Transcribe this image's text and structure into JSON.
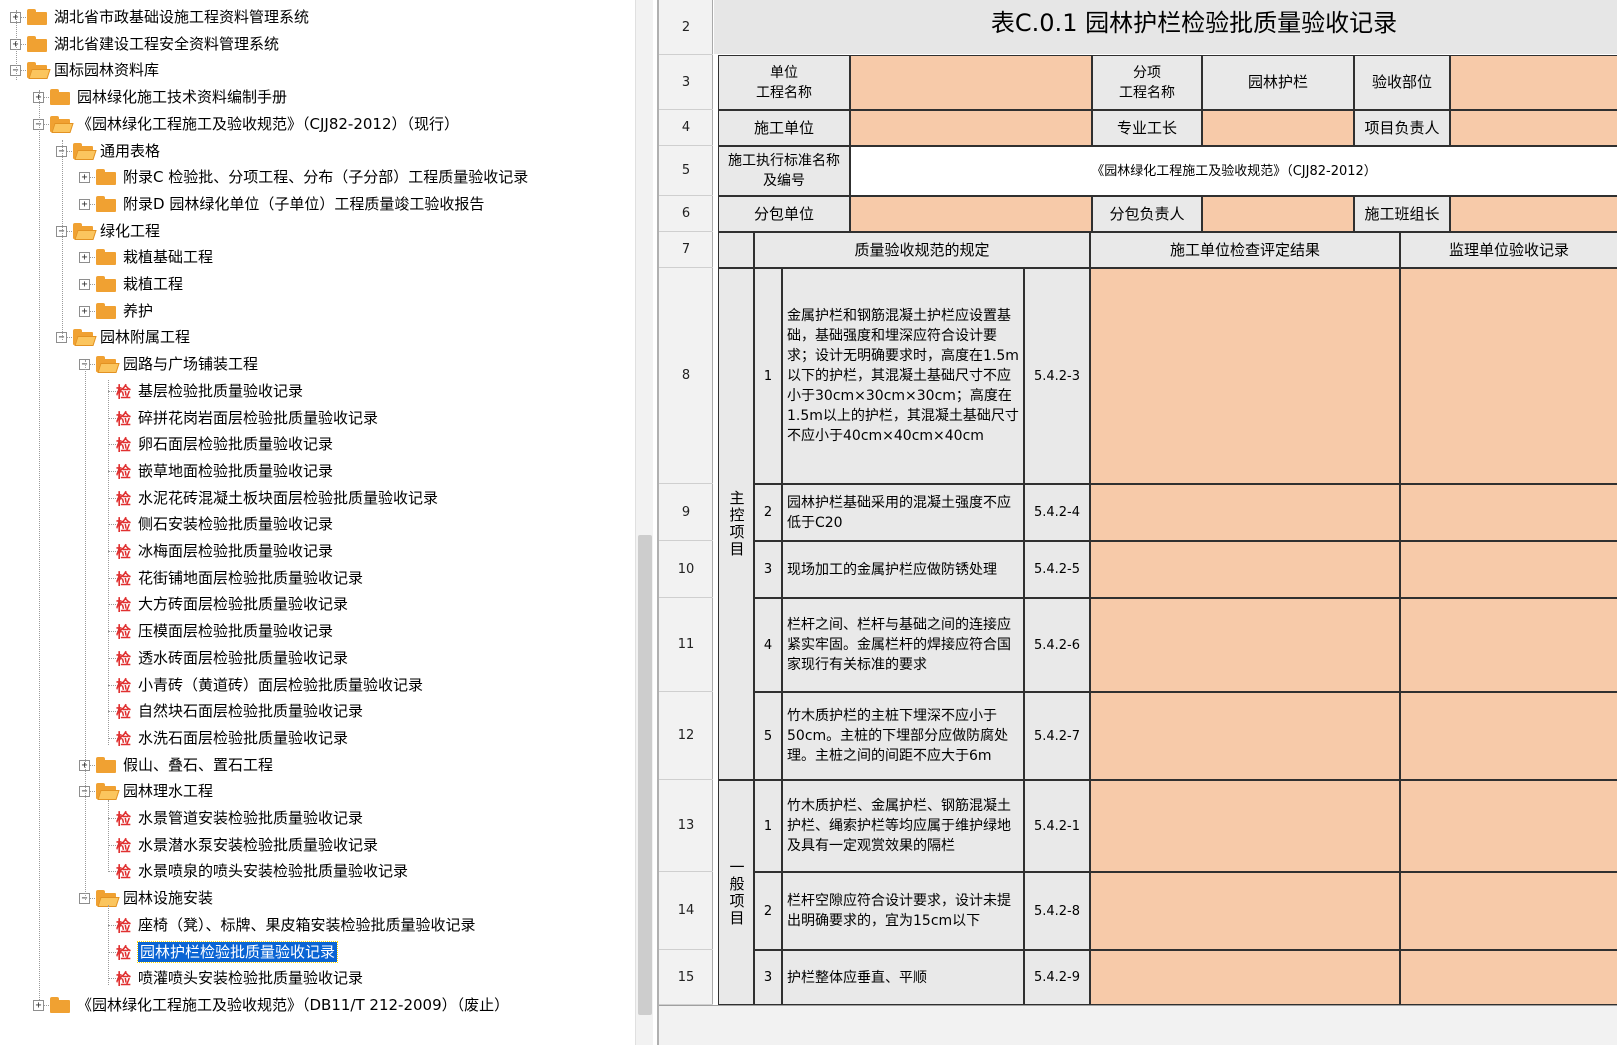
{
  "tree": {
    "items": [
      {
        "label": "湖北省市政基础设施工程资料管理系统",
        "type": "folder",
        "level": 0,
        "expanded": false
      },
      {
        "label": "湖北省建设工程安全资料管理系统",
        "type": "folder",
        "level": 0,
        "expanded": false
      },
      {
        "label": "国标园林资料库",
        "type": "folder",
        "level": 0,
        "expanded": true
      },
      {
        "label": "园林绿化施工技术资料编制手册",
        "type": "folder",
        "level": 1,
        "expanded": false
      },
      {
        "label": "《园林绿化工程施工及验收规范》（CJJ82-2012）（现行）",
        "type": "folder",
        "level": 1,
        "expanded": true
      },
      {
        "label": "通用表格",
        "type": "folder",
        "level": 2,
        "expanded": true
      },
      {
        "label": "附录C 检验批、分项工程、分布（子分部）工程质量验收记录",
        "type": "folder",
        "level": 3,
        "expanded": false
      },
      {
        "label": "附录D 园林绿化单位（子单位）工程质量竣工验收报告",
        "type": "folder",
        "level": 3,
        "expanded": false
      },
      {
        "label": "绿化工程",
        "type": "folder",
        "level": 2,
        "expanded": true
      },
      {
        "label": "栽植基础工程",
        "type": "folder",
        "level": 3,
        "expanded": false
      },
      {
        "label": "栽植工程",
        "type": "folder",
        "level": 3,
        "expanded": false
      },
      {
        "label": "养护",
        "type": "folder",
        "level": 3,
        "expanded": false
      },
      {
        "label": "园林附属工程",
        "type": "folder",
        "level": 2,
        "expanded": true
      },
      {
        "label": "园路与广场铺装工程",
        "type": "folder",
        "level": 3,
        "expanded": true
      },
      {
        "label": "基层检验批质量验收记录",
        "type": "doc",
        "level": 4
      },
      {
        "label": "碎拼花岗岩面层检验批质量验收记录",
        "type": "doc",
        "level": 4
      },
      {
        "label": "卵石面层检验批质量验收记录",
        "type": "doc",
        "level": 4
      },
      {
        "label": "嵌草地面检验批质量验收记录",
        "type": "doc",
        "level": 4
      },
      {
        "label": "水泥花砖混凝土板块面层检验批质量验收记录",
        "type": "doc",
        "level": 4
      },
      {
        "label": "侧石安装检验批质量验收记录",
        "type": "doc",
        "level": 4
      },
      {
        "label": "冰梅面层检验批质量验收记录",
        "type": "doc",
        "level": 4
      },
      {
        "label": "花街铺地面层检验批质量验收记录",
        "type": "doc",
        "level": 4
      },
      {
        "label": "大方砖面层检验批质量验收记录",
        "type": "doc",
        "level": 4
      },
      {
        "label": "压模面层检验批质量验收记录",
        "type": "doc",
        "level": 4
      },
      {
        "label": "透水砖面层检验批质量验收记录",
        "type": "doc",
        "level": 4
      },
      {
        "label": "小青砖（黄道砖）面层检验批质量验收记录",
        "type": "doc",
        "level": 4
      },
      {
        "label": "自然块石面层检验批质量验收记录",
        "type": "doc",
        "level": 4
      },
      {
        "label": "水洗石面层检验批质量验收记录",
        "type": "doc",
        "level": 4
      },
      {
        "label": "假山、叠石、置石工程",
        "type": "folder",
        "level": 3,
        "expanded": false
      },
      {
        "label": "园林理水工程",
        "type": "folder",
        "level": 3,
        "expanded": true
      },
      {
        "label": "水景管道安装检验批质量验收记录",
        "type": "doc",
        "level": 4
      },
      {
        "label": "水景潜水泵安装检验批质量验收记录",
        "type": "doc",
        "level": 4
      },
      {
        "label": "水景喷泉的喷头安装检验批质量验收记录",
        "type": "doc",
        "level": 4
      },
      {
        "label": "园林设施安装",
        "type": "folder",
        "level": 3,
        "expanded": true
      },
      {
        "label": "座椅（凳）、标牌、果皮箱安装检验批质量验收记录",
        "type": "doc",
        "level": 4
      },
      {
        "label": "园林护栏检验批质量验收记录",
        "type": "doc",
        "level": 4,
        "selected": true
      },
      {
        "label": "喷灌喷头安装检验批质量验收记录",
        "type": "doc",
        "level": 4
      },
      {
        "label": "《园林绿化工程施工及验收规范》（DB11/T 212-2009）（废止）",
        "type": "folder",
        "level": 1,
        "expanded": false
      }
    ],
    "doc_icon_glyph": "检"
  },
  "sheet": {
    "title": "表C.0.1  园林护栏检验批质量验收记录",
    "row_numbers": [
      "2",
      "3",
      "4",
      "5",
      "6",
      "7",
      "8",
      "9",
      "10",
      "11",
      "12",
      "13",
      "14",
      "15"
    ],
    "header": {
      "unit_project_name": "单位\n工程名称",
      "sub_project_name": "分项\n工程名称",
      "sub_project_value": "园林护栏",
      "acceptance_part": "验收部位",
      "construction_unit": "施工单位",
      "foreman": "专业工长",
      "project_manager": "项目负责人",
      "standard_name": "施工执行标准名称\n及编号",
      "standard_value": "《园林绿化工程施工及验收规范》（CJJ82-2012）",
      "subcontract_unit": "分包单位",
      "subcontract_manager": "分包负责人",
      "team_leader": "施工班组长",
      "quality_spec": "质量验收规范的规定",
      "construction_result": "施工单位检查评定结果",
      "supervision_record": "监理单位验收记录"
    },
    "main_section_label": "主控项目",
    "general_section_label": "一般项目",
    "main_items": [
      {
        "no": "1",
        "text": "金属护栏和钢筋混凝土护栏应设置基础，基础强度和埋深应符合设计要求；设计无明确要求时，高度在1.5m以下的护栏，其混凝土基础尺寸不应小于30cm×30cm×30cm；高度在1.5m以上的护栏，其混凝土基础尺寸不应小于40cm×40cm×40cm",
        "clause": "5.4.2-3"
      },
      {
        "no": "2",
        "text": "园林护栏基础采用的混凝土强度不应低于C20",
        "clause": "5.4.2-4"
      },
      {
        "no": "3",
        "text": "现场加工的金属护栏应做防锈处理",
        "clause": "5.4.2-5"
      },
      {
        "no": "4",
        "text": "栏杆之间、栏杆与基础之间的连接应紧实牢固。金属栏杆的焊接应符合国家现行有关标准的要求",
        "clause": "5.4.2-6"
      },
      {
        "no": "5",
        "text": "竹木质护栏的主桩下埋深不应小于50cm。主桩的下埋部分应做防腐处理。主桩之间的间距不应大于6m",
        "clause": "5.4.2-7"
      }
    ],
    "general_items": [
      {
        "no": "1",
        "text": "竹木质护栏、金属护栏、钢筋混凝土护栏、绳索护栏等均应属于维护绿地及具有一定观赏效果的隔栏",
        "clause": "5.4.2-1"
      },
      {
        "no": "2",
        "text": "栏杆空隙应符合设计要求，设计未提出明确要求的，宜为15cm以下",
        "clause": "5.4.2-8"
      },
      {
        "no": "3",
        "text": "护栏整体应垂直、平顺",
        "clause": "5.4.2-9"
      }
    ]
  },
  "colors": {
    "input_fill": "#f7caa9",
    "label_fill": "#e9e9e9",
    "selection": "#0a64d4",
    "folder": "#f0a132",
    "doc_icon": "#e03030"
  }
}
